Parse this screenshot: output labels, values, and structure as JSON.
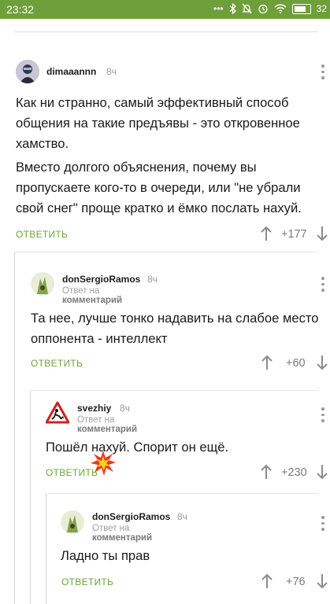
{
  "status_bar": {
    "time": "23:32",
    "icons": [
      "dots-icon",
      "bluetooth-icon",
      "mute-icon",
      "alarm-icon",
      "wifi-icon",
      "battery-icon"
    ],
    "battery": "32"
  },
  "colors": {
    "accent": "#6aa53a",
    "status_bar": "#6e9f3b",
    "muted": "#9a9a9a"
  },
  "reply_label": "ответить",
  "comments": [
    {
      "user": "dimaaannn",
      "time": "8ч",
      "text1": "Как ни странно, самый эффективный способ общения на такие предъявы - это откровенное хамство.",
      "text2": "Вместо долгого объяснения, почему вы пропускаете кого-то в очереди, или \"не убрали свой снег\" проще кратко и ёмко послать нахуй.",
      "rating": "+177"
    },
    {
      "user": "donSergioRamos",
      "time": "8ч",
      "reply_prefix": "Ответ на",
      "reply_target": "комментарий",
      "text": "Та нее, лучше тонко надавить на слабое место оппонента - интеллект",
      "rating": "+60"
    },
    {
      "user": "svezhiy",
      "time": "8ч",
      "reply_prefix": "Ответ на",
      "reply_target": "комментарий",
      "text": "Пошёл нахуй. Спорит он ещё.",
      "rating": "+230"
    },
    {
      "user": "donSergioRamos",
      "time": "8ч",
      "reply_prefix": "Ответ на",
      "reply_target": "комментарий",
      "text": "Ладно ты прав",
      "rating": "+76"
    }
  ]
}
